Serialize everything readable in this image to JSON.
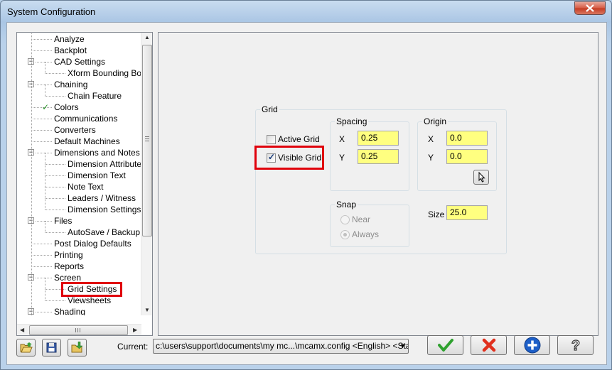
{
  "window": {
    "title": "System Configuration"
  },
  "tree": {
    "items": [
      {
        "label": "Analyze"
      },
      {
        "label": "Backplot"
      },
      {
        "label": "CAD Settings",
        "expander": "−"
      },
      {
        "label": "Xform Bounding Box F"
      },
      {
        "label": "Chaining",
        "expander": "−"
      },
      {
        "label": "Chain Feature"
      },
      {
        "label": "Colors",
        "check": "✓"
      },
      {
        "label": "Communications"
      },
      {
        "label": "Converters"
      },
      {
        "label": "Default Machines"
      },
      {
        "label": "Dimensions and Notes",
        "expander": "−"
      },
      {
        "label": "Dimension Attributes"
      },
      {
        "label": "Dimension Text"
      },
      {
        "label": "Note Text"
      },
      {
        "label": "Leaders / Witness"
      },
      {
        "label": "Dimension Settings"
      },
      {
        "label": "Files",
        "expander": "−"
      },
      {
        "label": "AutoSave / Backup"
      },
      {
        "label": "Post Dialog Defaults"
      },
      {
        "label": "Printing"
      },
      {
        "label": "Reports"
      },
      {
        "label": "Screen",
        "expander": "−"
      },
      {
        "label": "Grid Settings",
        "selected": true
      },
      {
        "label": "Viewsheets"
      },
      {
        "label": "Shading",
        "expander": "−"
      }
    ]
  },
  "grid": {
    "group_label": "Grid",
    "active_grid_label": "Active Grid",
    "active_grid_checked": false,
    "visible_grid_label": "Visible Grid",
    "visible_grid_checked": true,
    "spacing": {
      "label": "Spacing",
      "x_label": "X",
      "x_value": "0.25",
      "y_label": "Y",
      "y_value": "0.25"
    },
    "origin": {
      "label": "Origin",
      "x_label": "X",
      "x_value": "0.0",
      "y_label": "Y",
      "y_value": "0.0"
    },
    "snap": {
      "label": "Snap",
      "near_label": "Near",
      "always_label": "Always",
      "selected": "Always"
    },
    "size": {
      "label": "Size",
      "value": "25.0"
    }
  },
  "footer": {
    "current_label": "Current:",
    "current_path": "c:\\users\\support\\documents\\my mc...\\mcamx.config <English> <Startu"
  },
  "colors": {
    "input_bg": "#ffff80",
    "highlight": "#e0000b",
    "ok_green": "#2fa12f",
    "cancel_red": "#e0301e",
    "apply_blue": "#1d5fc8"
  }
}
